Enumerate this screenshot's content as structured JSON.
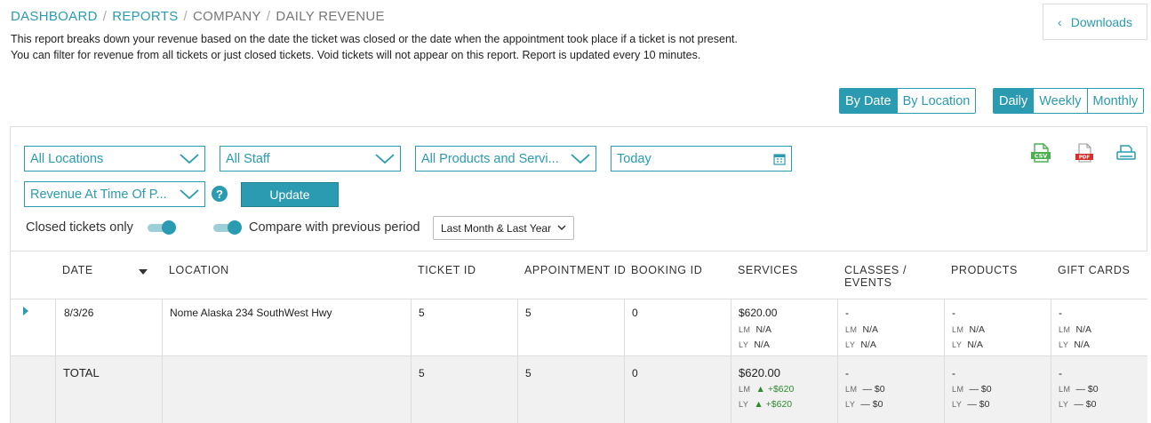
{
  "breadcrumb": {
    "dashboard": "DASHBOARD",
    "reports": "REPORTS",
    "company": "COMPANY",
    "current": "DAILY REVENUE",
    "separator": "/"
  },
  "description": "This report breaks down your revenue based on the date the ticket was closed or the date when the appointment took place if a ticket is not present. You can filter for revenue from all tickets or just closed tickets. Void tickets will not appear on this report. Report is updated every 10 minutes.",
  "downloads": {
    "label": "Downloads",
    "icon": "chevron-left-icon"
  },
  "view_toggle": {
    "by_date": "By Date",
    "by_location": "By Location",
    "active": "By Date"
  },
  "period_toggle": {
    "daily": "Daily",
    "weekly": "Weekly",
    "monthly": "Monthly",
    "active": "Daily"
  },
  "filters": {
    "locations": "All Locations",
    "staff": "All Staff",
    "products": "All Products and Servi...",
    "date": "Today",
    "revenue_type": "Revenue At Time Of P...",
    "update": "Update",
    "help": "?"
  },
  "toggles": {
    "closed_only": {
      "label": "Closed tickets only",
      "on": true
    },
    "compare": {
      "label": "Compare with previous period",
      "on": true
    },
    "compare_select": "Last Month & Last Year"
  },
  "export_icons": {
    "csv": "CSV",
    "pdf": "PDF",
    "print": "print-icon"
  },
  "table": {
    "headers": {
      "date": "DATE",
      "location": "LOCATION",
      "ticket_id": "TICKET ID",
      "appointment_id": "APPOINTMENT ID",
      "booking_id": "BOOKING ID",
      "services": "SERVICES",
      "classes_l1": "CLASSES /",
      "classes_l2": "EVENTS",
      "products": "PRODUCTS",
      "gift_cards": "GIFT CARDS"
    },
    "row": {
      "date": "8/3/26",
      "location": "Nome Alaska 234 SouthWest Hwy",
      "ticket_id": "5",
      "appointment_id": "5",
      "booking_id": "0",
      "services": "$620.00",
      "services_lm": "N/A",
      "services_ly": "N/A",
      "classes": "-",
      "classes_lm": "N/A",
      "classes_ly": "N/A",
      "products": "-",
      "products_lm": "N/A",
      "products_ly": "N/A",
      "gift_cards": "-",
      "gift_cards_lm": "N/A",
      "gift_cards_ly": "N/A"
    },
    "total": {
      "label": "TOTAL",
      "ticket_id": "5",
      "appointment_id": "5",
      "booking_id": "0",
      "services": "$620.00",
      "services_lm": "▲ +$620",
      "services_ly": "▲ +$620",
      "classes": "-",
      "classes_lm": "— $0",
      "classes_ly": "— $0",
      "products": "-",
      "products_lm": "— $0",
      "products_ly": "— $0",
      "gift_cards": "-",
      "gift_cards_lm": "— $0",
      "gift_cards_ly": "— $0"
    },
    "lm_label": "LM",
    "ly_label": "LY"
  },
  "colors": {
    "accent": "#2a9bb0",
    "positive": "#2e8b2e",
    "csv": "#4caf50",
    "pdf": "#d32f2f"
  }
}
